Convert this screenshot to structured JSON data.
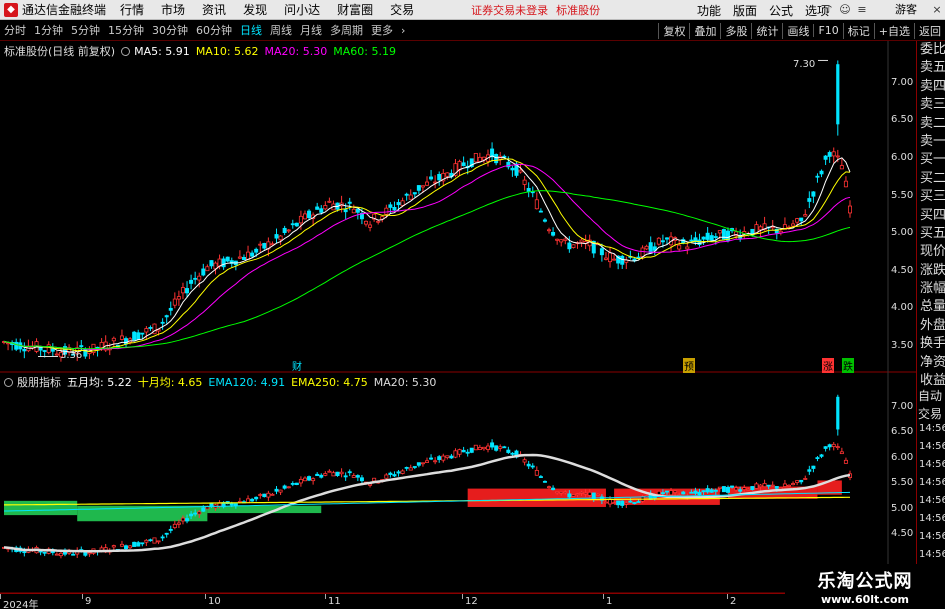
{
  "menubar": {
    "app_title": "通达信金融终端",
    "items": [
      "行情",
      "市场",
      "资讯",
      "发现",
      "问小达",
      "财富圈",
      "交易"
    ],
    "login_status": "证券交易未登录",
    "stock_name": "标准股份",
    "right_items": [
      "功能",
      "版面",
      "公式",
      "选项"
    ],
    "guest": "游客"
  },
  "periodbar": {
    "items": [
      "分时",
      "1分钟",
      "5分钟",
      "15分钟",
      "30分钟",
      "60分钟",
      "日线",
      "周线",
      "月线",
      "多周期",
      "更多"
    ],
    "selected": "日线",
    "tools": [
      "复权",
      "叠加",
      "多股",
      "统计",
      "画线",
      "F10",
      "标记",
      "+自选",
      "返回"
    ]
  },
  "main_panel": {
    "title": "标准股份(日线 前复权)",
    "indicators": [
      {
        "label": "MA5: 5.91",
        "color": "#ffffff"
      },
      {
        "label": "MA10: 5.62",
        "color": "#ffff00"
      },
      {
        "label": "MA20: 5.30",
        "color": "#ff00ff"
      },
      {
        "label": "MA60: 5.19",
        "color": "#00ff00"
      }
    ],
    "price_ticks": [
      "7.00",
      "6.50",
      "6.00",
      "5.50",
      "5.00",
      "4.50",
      "4.00",
      "3.50"
    ],
    "high_label": "7.30",
    "low_label": "3.36",
    "markers": [
      "财",
      "预",
      "涨",
      "跌"
    ]
  },
  "sub_panel": {
    "title": "殷朋指标",
    "indicators": [
      {
        "label": "五月均: 5.22",
        "color": "#ffffff"
      },
      {
        "label": "十月均: 4.65",
        "color": "#ffff00"
      },
      {
        "label": "EMA120: 4.91",
        "color": "#00e5ff"
      },
      {
        "label": "EMA250: 4.75",
        "color": "#ffff00"
      },
      {
        "label": "MA20: 5.30",
        "color": "#dddddd"
      }
    ],
    "price_ticks": [
      "7.00",
      "6.50",
      "6.00",
      "5.50",
      "5.00",
      "4.50"
    ],
    "right_times": [
      "14:56",
      "14:56",
      "14:56",
      "14:56",
      "14:56",
      "14:56",
      "14:56",
      "14:56"
    ]
  },
  "side_panel": {
    "items": [
      "委比",
      "卖五",
      "卖四",
      "卖三",
      "卖二",
      "卖一",
      "买一",
      "买二",
      "买三",
      "买四",
      "买五",
      "现价",
      "涨跌",
      "涨幅",
      "总量",
      "外盘",
      "换手",
      "净资",
      "收益"
    ],
    "auto_items": [
      "自动",
      "交易"
    ]
  },
  "date_axis": {
    "labels": [
      "2024年",
      "9",
      "10",
      "11",
      "12",
      "1",
      "2"
    ]
  },
  "watermark": {
    "title": "乐淘公式网",
    "url": "www.60lt.com"
  },
  "colors": {
    "up": "#ff3333",
    "down": "#00e5ff",
    "ma5": "#ffffff",
    "ma10": "#ffff00",
    "ma20": "#ff00ff",
    "ma60": "#00ff00",
    "grid": "#8a0000"
  }
}
